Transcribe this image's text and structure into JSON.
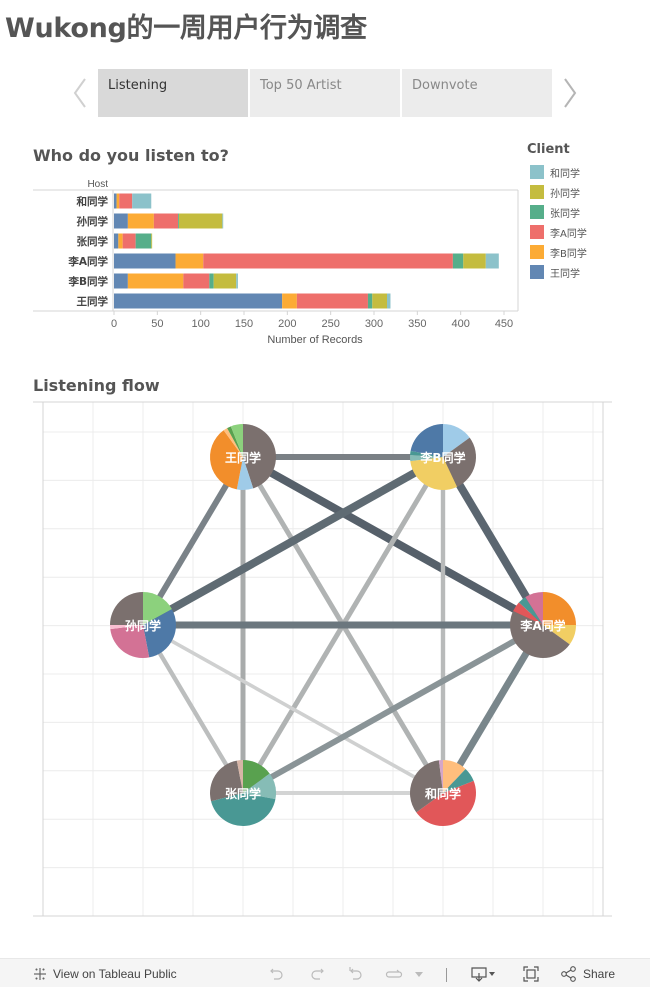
{
  "page": {
    "title": "Wukong的一周用户行为调查"
  },
  "tabs": {
    "prev_icon": "chevron-left-icon",
    "next_icon": "chevron-right-icon",
    "items": [
      {
        "label": "Listening",
        "active": true
      },
      {
        "label": "Top 50 Artist",
        "active": false
      },
      {
        "label": "Downvote",
        "active": false
      }
    ]
  },
  "bar_section": {
    "title": "Who do you listen to?"
  },
  "flow_section": {
    "title": "Listening flow"
  },
  "legend": {
    "title": "Client",
    "items": [
      {
        "label": "和同学",
        "color": "#8cc2ca"
      },
      {
        "label": "孙同学",
        "color": "#c4bc3f"
      },
      {
        "label": "张同学",
        "color": "#56ae8a"
      },
      {
        "label": "李A同学",
        "color": "#ee6f6b"
      },
      {
        "label": "李B同学",
        "color": "#fcab35"
      },
      {
        "label": "王同学",
        "color": "#6287b3"
      }
    ]
  },
  "chart_data": [
    {
      "type": "bar",
      "orientation": "horizontal",
      "stacked": true,
      "title": "Who do you listen to?",
      "row_header": "Host",
      "xlabel": "Number of Records",
      "ylabel": "Host",
      "xlim": [
        0,
        460
      ],
      "x_ticks": [
        0,
        50,
        100,
        150,
        200,
        250,
        300,
        350,
        400,
        450
      ],
      "grid": false,
      "legend_position": "right",
      "legend_title": "Client",
      "categories": [
        "和同学",
        "孙同学",
        "张同学",
        "李A同学",
        "李B同学",
        "王同学"
      ],
      "series": [
        {
          "name": "王同学",
          "color": "#6287b3",
          "values": [
            3,
            16,
            5,
            71,
            16,
            194
          ]
        },
        {
          "name": "李B同学",
          "color": "#fcab35",
          "values": [
            3,
            30,
            5,
            32,
            64,
            17
          ]
        },
        {
          "name": "李A同学",
          "color": "#ee6f6b",
          "values": [
            15,
            28,
            15,
            288,
            30,
            82
          ]
        },
        {
          "name": "张同学",
          "color": "#56ae8a",
          "values": [
            0,
            1,
            18,
            12,
            5,
            5
          ]
        },
        {
          "name": "孙同学",
          "color": "#c4bc3f",
          "values": [
            0,
            50,
            1,
            26,
            26,
            17
          ]
        },
        {
          "name": "和同学",
          "color": "#8cc2ca",
          "values": [
            22,
            1,
            0,
            15,
            2,
            4
          ]
        }
      ]
    },
    {
      "type": "network",
      "title": "Listening flow",
      "nodes": [
        {
          "id": "王同学",
          "slices": [
            {
              "color": "#7b706e",
              "value": 45
            },
            {
              "color": "#9fcbe8",
              "value": 8
            },
            {
              "color": "#f28e2b",
              "value": 37
            },
            {
              "color": "#ffbe7d",
              "value": 2
            },
            {
              "color": "#59a14f",
              "value": 2
            },
            {
              "color": "#8cd17d",
              "value": 6
            }
          ]
        },
        {
          "id": "李B同学",
          "slices": [
            {
              "color": "#9fcbe8",
              "value": 15
            },
            {
              "color": "#7b706e",
              "value": 28
            },
            {
              "color": "#f1ce63",
              "value": 30
            },
            {
              "color": "#86bcb6",
              "value": 3
            },
            {
              "color": "#499894",
              "value": 2
            },
            {
              "color": "#4e79a7",
              "value": 22
            }
          ]
        },
        {
          "id": "孙同学",
          "slices": [
            {
              "color": "#8cd17d",
              "value": 17
            },
            {
              "color": "#4e79a7",
              "value": 30
            },
            {
              "color": "#d37295",
              "value": 26
            },
            {
              "color": "#fabfd2",
              "value": 2
            },
            {
              "color": "#7b706e",
              "value": 25
            }
          ]
        },
        {
          "id": "李A同学",
          "slices": [
            {
              "color": "#f28e2b",
              "value": 25
            },
            {
              "color": "#f1ce63",
              "value": 10
            },
            {
              "color": "#7b706e",
              "value": 47
            },
            {
              "color": "#e15759",
              "value": 5
            },
            {
              "color": "#499894",
              "value": 4
            },
            {
              "color": "#d37295",
              "value": 9
            }
          ]
        },
        {
          "id": "张同学",
          "slices": [
            {
              "color": "#59a14f",
              "value": 15
            },
            {
              "color": "#86bcb6",
              "value": 13
            },
            {
              "color": "#499894",
              "value": 43
            },
            {
              "color": "#7b706e",
              "value": 26
            },
            {
              "color": "#d7b5a6",
              "value": 3
            }
          ]
        },
        {
          "id": "和同学",
          "slices": [
            {
              "color": "#ffbe7d",
              "value": 12
            },
            {
              "color": "#499894",
              "value": 7
            },
            {
              "color": "#e15759",
              "value": 46
            },
            {
              "color": "#7b706e",
              "value": 33
            },
            {
              "color": "#d4a6c8",
              "value": 2
            }
          ]
        }
      ],
      "edges": [
        {
          "from": "王同学",
          "to": "李B同学",
          "color": "#7a8085",
          "weight": 3
        },
        {
          "from": "王同学",
          "to": "李A同学",
          "color": "#56606a",
          "weight": 4
        },
        {
          "from": "王同学",
          "to": "孙同学",
          "color": "#7a8288",
          "weight": 3
        },
        {
          "from": "王同学",
          "to": "张同学",
          "color": "#a8abab",
          "weight": 2.5
        },
        {
          "from": "王同学",
          "to": "和同学",
          "color": "#b0b3b3",
          "weight": 2.5
        },
        {
          "from": "李B同学",
          "to": "孙同学",
          "color": "#5f6b73",
          "weight": 4
        },
        {
          "from": "李B同学",
          "to": "李A同学",
          "color": "#5b6670",
          "weight": 4
        },
        {
          "from": "李B同学",
          "to": "张同学",
          "color": "#b0b3b3",
          "weight": 2.5
        },
        {
          "from": "李B同学",
          "to": "和同学",
          "color": "#b8baba",
          "weight": 2.2
        },
        {
          "from": "孙同学",
          "to": "李A同学",
          "color": "#6b777e",
          "weight": 3.5
        },
        {
          "from": "孙同学",
          "to": "张同学",
          "color": "#bcbebe",
          "weight": 2.2
        },
        {
          "from": "孙同学",
          "to": "和同学",
          "color": "#cfd0d0",
          "weight": 1.8
        },
        {
          "from": "李A同学",
          "to": "张同学",
          "color": "#8a9497",
          "weight": 3
        },
        {
          "from": "李A同学",
          "to": "和同学",
          "color": "#79868b",
          "weight": 3.5
        },
        {
          "from": "张同学",
          "to": "和同学",
          "color": "#d3d4d4",
          "weight": 2
        }
      ]
    }
  ],
  "footer": {
    "view_public_label": "View on Tableau Public",
    "view_public_icon": "tableau-logo-icon",
    "undo_icon": "undo-icon",
    "redo_icon": "redo-icon",
    "revert_icon": "revert-icon",
    "refresh_icon": "refresh-icon",
    "download_icon": "download-icon",
    "fullscreen_icon": "fullscreen-icon",
    "share_label": "Share",
    "share_icon": "share-icon"
  }
}
